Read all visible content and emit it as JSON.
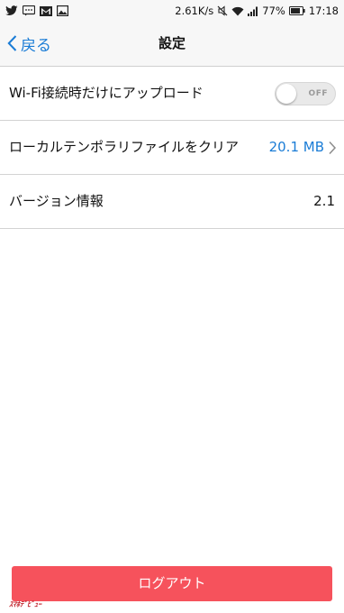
{
  "status_bar": {
    "network_speed": "2.61K/s",
    "battery": "77%",
    "time": "17:18",
    "icons": [
      "twitter-icon",
      "chat-icon",
      "gmail-icon",
      "image-icon",
      "mute-icon",
      "wifi-icon",
      "signal-icon",
      "battery-icon"
    ]
  },
  "nav": {
    "back_label": "戻る",
    "title": "設定"
  },
  "settings": {
    "wifi_upload": {
      "label": "Wi-Fi接続時だけにアップロード",
      "toggle_state": "OFF"
    },
    "clear_temp": {
      "label": "ローカルテンポラリファイルをクリア",
      "value": "20.1 MB"
    },
    "version": {
      "label": "バージョン情報",
      "value": "2.1"
    }
  },
  "logout": {
    "label": "ログアウト"
  },
  "colors": {
    "accent": "#1a7cd6",
    "logout_bg": "#f6525c",
    "bar_bg": "#f7f7f7",
    "divider": "#d3d3d3"
  }
}
